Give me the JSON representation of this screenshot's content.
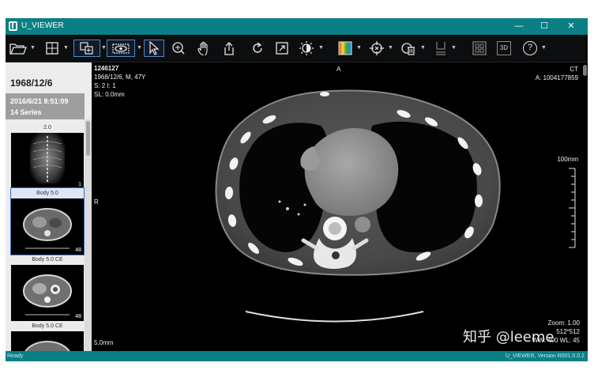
{
  "window": {
    "title": "U_VIEWER",
    "minimize_glyph": "—",
    "maximize_glyph": "☐",
    "close_glyph": "✕"
  },
  "toolbar": {
    "icons": [
      "folder-open-icon",
      "layout-grid-icon",
      "series-layout-icon",
      "eye-icon",
      "pointer-icon",
      "zoom-icon",
      "pan-hand-icon",
      "scroll-arrow-icon",
      "rotate-icon",
      "fit-window-icon",
      "window-level-icon",
      "color-map-icon",
      "crosshair-icon",
      "measure-icon",
      "sort-icon",
      "grid-view-icon",
      "3d-icon",
      "help-icon"
    ],
    "label_3d": "3D",
    "help": "?"
  },
  "sidebar": {
    "patient_dob": "1968/12/6",
    "study_datetime": "2016/6/21 8:51:09",
    "series_count_label": "14 Series",
    "series": [
      {
        "label": "2.0",
        "count": "1"
      },
      {
        "label": "Body 5.0",
        "count": "48"
      },
      {
        "label": "Body 5.0 CE",
        "count": "48"
      },
      {
        "label": "Body 5.0 CE",
        "count": ""
      }
    ]
  },
  "viewport": {
    "patient_id": "1246127",
    "patient_info": "1968/12/6, M, 47Y",
    "slice_info": "S: 2 I: 1",
    "slice_location": "SL: 0.0mm",
    "orientation_top": "A",
    "orientation_left": "R",
    "modality": "CT",
    "accession": "A: 1004177859",
    "scale_label": "100mm",
    "thickness": "5.0mm",
    "zoom": "Zoom: 1.00",
    "matrix": "512*512",
    "window_level": "WW: 400 WL: 45"
  },
  "status": {
    "left": "Ready",
    "right": "U_VIEWER, Version R001.0.0.2"
  },
  "watermark": "知乎 @leeme"
}
